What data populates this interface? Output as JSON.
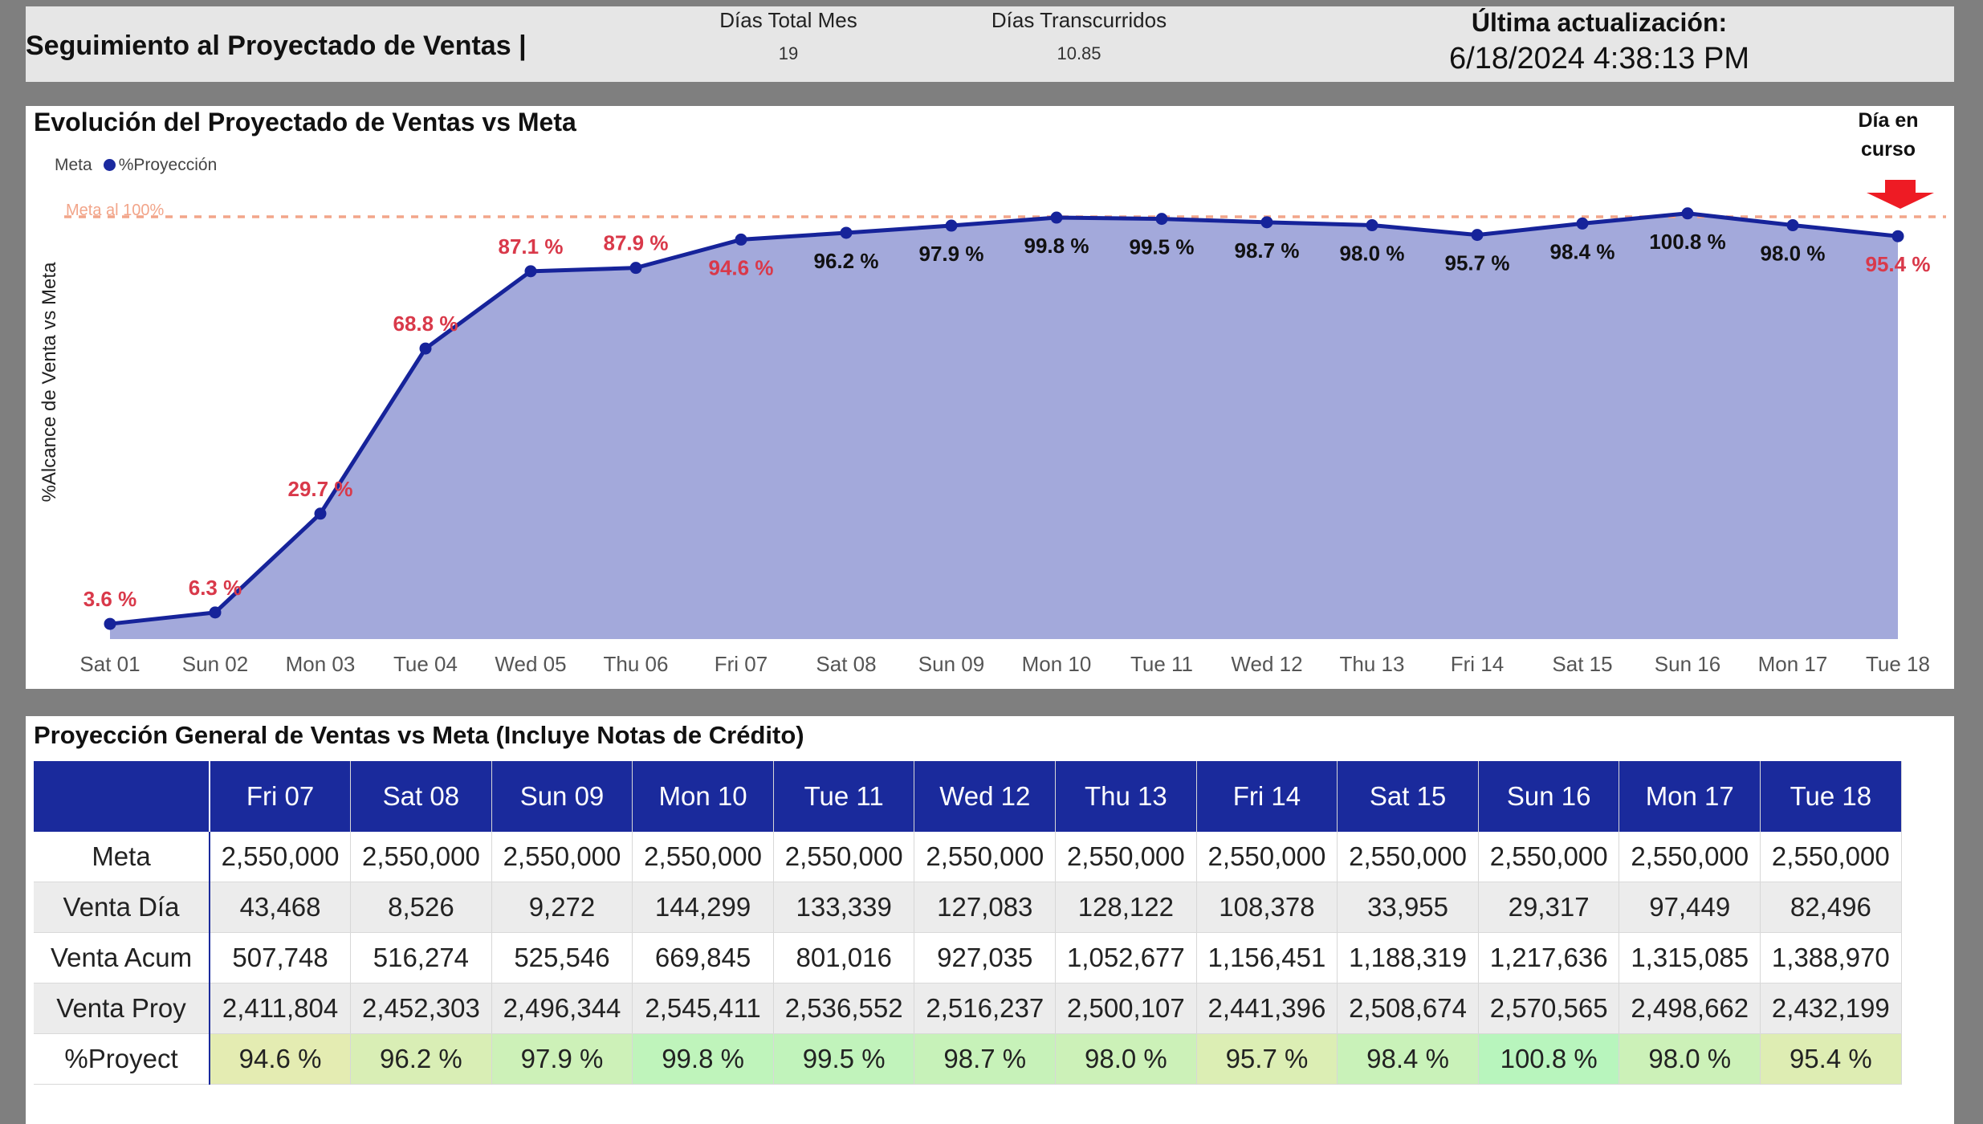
{
  "header": {
    "title": "Seguimiento al Proyectado de Ventas |",
    "days_total_label": "Días Total Mes",
    "days_total_value": "19",
    "days_elapsed_label": "Días Transcurridos",
    "days_elapsed_value": "10.85",
    "last_update_label": "Última actualización:",
    "last_update_value": "6/18/2024 4:38:13 PM"
  },
  "chart": {
    "title": "Evolución del Proyectado de Ventas vs Meta",
    "legend": {
      "meta": "Meta",
      "proyeccion": "%Proyección"
    },
    "day_marker": [
      "Día en",
      "curso"
    ],
    "ylabel": "%Alcance de Venta vs Meta",
    "meta_label": "Meta al 100%"
  },
  "chart_data": {
    "type": "area",
    "categories": [
      "Sat 01",
      "Sun 02",
      "Mon 03",
      "Tue 04",
      "Wed 05",
      "Thu 06",
      "Fri 07",
      "Sat 08",
      "Sun 09",
      "Mon 10",
      "Tue 11",
      "Wed 12",
      "Thu 13",
      "Fri 14",
      "Sat 15",
      "Sun 16",
      "Mon 17",
      "Tue 18"
    ],
    "series": [
      {
        "name": "%Proyección",
        "values": [
          3.6,
          6.3,
          29.7,
          68.8,
          87.1,
          87.9,
          94.6,
          96.2,
          97.9,
          99.8,
          99.5,
          98.7,
          98.0,
          95.7,
          98.4,
          100.8,
          98.0,
          95.4
        ]
      }
    ],
    "labels": [
      "3.6 %",
      "6.3 %",
      "29.7 %",
      "68.8 %",
      "87.1 %",
      "87.9 %",
      "94.6 %",
      "96.2 %",
      "97.9 %",
      "99.8 %",
      "99.5 %",
      "98.7 %",
      "98.0 %",
      "95.7 %",
      "98.4 %",
      "100.8 %",
      "98.0 %",
      "95.4 %"
    ],
    "label_colors": [
      "red",
      "red",
      "red",
      "red",
      "red",
      "red",
      "red",
      "black",
      "black",
      "black",
      "black",
      "black",
      "black",
      "black",
      "black",
      "black",
      "black",
      "red"
    ],
    "reference_line": {
      "name": "Meta",
      "value": 100
    },
    "ylim": [
      0,
      102
    ],
    "colors": {
      "line": "#16239a",
      "fill": "#a3a9db",
      "meta": "#f2a58a",
      "label_red": "#d9394a",
      "label_black": "#111111",
      "arrow": "#ee1b24"
    }
  },
  "table": {
    "title": "Proyección General de Ventas vs Meta (Incluye Notas de Crédito)",
    "columns": [
      "Fri 07",
      "Sat 08",
      "Sun 09",
      "Mon 10",
      "Tue 11",
      "Wed 12",
      "Thu 13",
      "Fri 14",
      "Sat 15",
      "Sun 16",
      "Mon 17",
      "Tue 18"
    ],
    "rows": [
      {
        "label": "Meta",
        "values": [
          "2,550,000",
          "2,550,000",
          "2,550,000",
          "2,550,000",
          "2,550,000",
          "2,550,000",
          "2,550,000",
          "2,550,000",
          "2,550,000",
          "2,550,000",
          "2,550,000",
          "2,550,000"
        ]
      },
      {
        "label": "Venta Día",
        "values": [
          "43,468",
          "8,526",
          "9,272",
          "144,299",
          "133,339",
          "127,083",
          "128,122",
          "108,378",
          "33,955",
          "29,317",
          "97,449",
          "82,496"
        ]
      },
      {
        "label": "Venta Acum",
        "values": [
          "507,748",
          "516,274",
          "525,546",
          "669,845",
          "801,016",
          "927,035",
          "1,052,677",
          "1,156,451",
          "1,188,319",
          "1,217,636",
          "1,315,085",
          "1,388,970"
        ]
      },
      {
        "label": "Venta Proy",
        "values": [
          "2,411,804",
          "2,452,303",
          "2,496,344",
          "2,545,411",
          "2,536,552",
          "2,516,237",
          "2,500,107",
          "2,441,396",
          "2,508,674",
          "2,570,565",
          "2,498,662",
          "2,432,199"
        ]
      },
      {
        "label": "%Proyect",
        "values": [
          "94.6 %",
          "96.2 %",
          "97.9 %",
          "99.8 %",
          "99.5 %",
          "98.7 %",
          "98.0 %",
          "95.7 %",
          "98.4 %",
          "100.8 %",
          "98.0 %",
          "95.4 %"
        ]
      }
    ],
    "proyect_values": [
      94.6,
      96.2,
      97.9,
      99.8,
      99.5,
      98.7,
      98.0,
      95.7,
      98.4,
      100.8,
      98.0,
      95.4
    ],
    "colors": {
      "header_bg": "#1a2a9c",
      "header_text": "#ffffff",
      "low": "#e4ecb2",
      "high": "#b8f5bd"
    }
  }
}
